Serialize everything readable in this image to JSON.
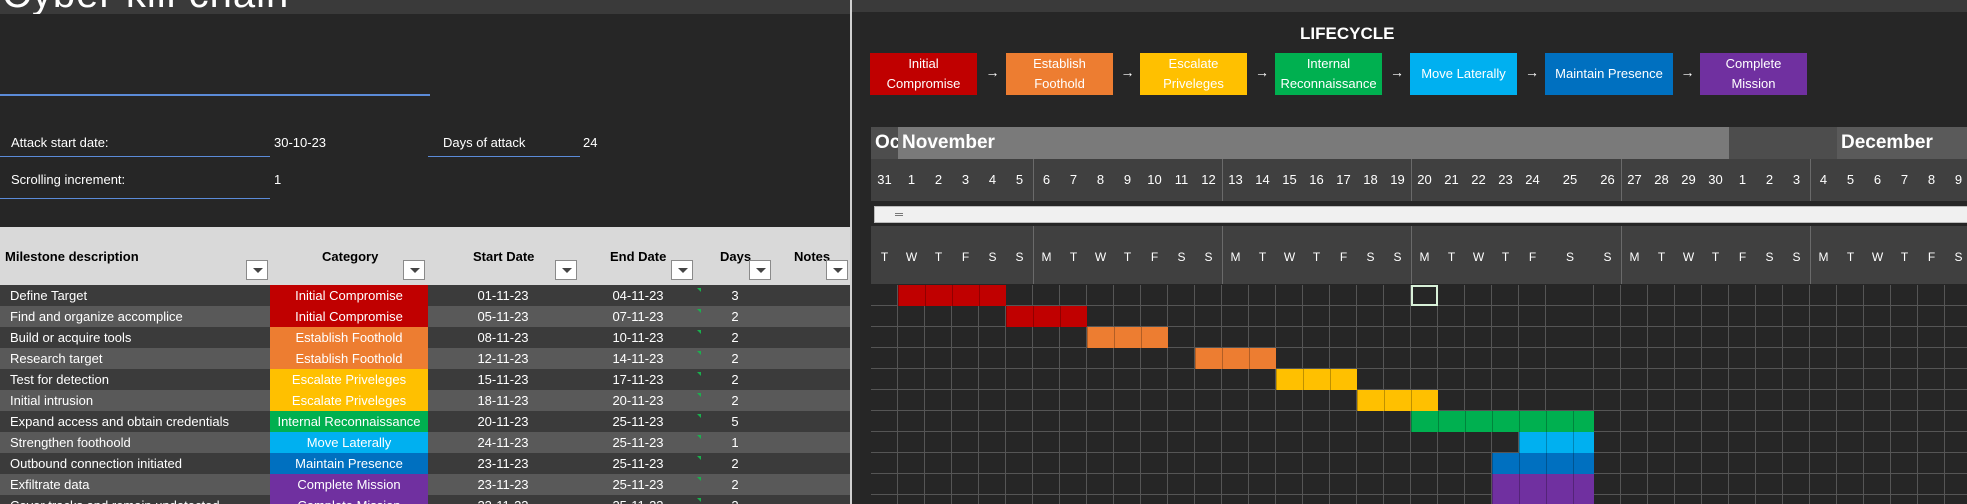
{
  "title": "Cyber kill chain",
  "fields": {
    "attack_start_label": "Attack start date:",
    "attack_start_value": "30-10-23",
    "days_label": "Days of attack",
    "days_value": "24",
    "scroll_label": "Scrolling increment:",
    "scroll_value": "1"
  },
  "table": {
    "headers": [
      "Milestone description",
      "Category",
      "Start Date",
      "End Date",
      "Days",
      "Notes"
    ],
    "rows": [
      {
        "desc": "Define Target",
        "cat": "Initial Compromise",
        "start": "01-11-23",
        "end": "04-11-23",
        "days": "3",
        "color": "#c00000"
      },
      {
        "desc": "Find and organize accomplice",
        "cat": "Initial Compromise",
        "start": "05-11-23",
        "end": "07-11-23",
        "days": "2",
        "color": "#c00000"
      },
      {
        "desc": "Build or acquire tools",
        "cat": "Establish Foothold",
        "start": "08-11-23",
        "end": "10-11-23",
        "days": "2",
        "color": "#ed7d31"
      },
      {
        "desc": "Research target",
        "cat": "Establish Foothold",
        "start": "12-11-23",
        "end": "14-11-23",
        "days": "2",
        "color": "#ed7d31"
      },
      {
        "desc": "Test for detection",
        "cat": "Escalate Priveleges",
        "start": "15-11-23",
        "end": "17-11-23",
        "days": "2",
        "color": "#ffc000"
      },
      {
        "desc": "Initial intrusion",
        "cat": "Escalate Priveleges",
        "start": "18-11-23",
        "end": "20-11-23",
        "days": "2",
        "color": "#ffc000"
      },
      {
        "desc": "Expand access and obtain credentials",
        "cat": "Internal Reconnaissance",
        "start": "20-11-23",
        "end": "25-11-23",
        "days": "5",
        "color": "#00b050"
      },
      {
        "desc": "Strengthen foothoold",
        "cat": "Move Laterally",
        "start": "24-11-23",
        "end": "25-11-23",
        "days": "1",
        "color": "#00b0f0"
      },
      {
        "desc": "Outbound connection initiated",
        "cat": "Maintain Presence",
        "start": "23-11-23",
        "end": "25-11-23",
        "days": "2",
        "color": "#0070c0"
      },
      {
        "desc": "Exfiltrate data",
        "cat": "Complete Mission",
        "start": "23-11-23",
        "end": "25-11-23",
        "days": "2",
        "color": "#7030a0"
      },
      {
        "desc": "Cover tracks and remain undetected",
        "cat": "Complete Mission",
        "start": "23-11-23",
        "end": "25-11-23",
        "days": "2",
        "color": "#7030a0"
      }
    ]
  },
  "lifecycle": {
    "title": "LIFECYCLE",
    "arrow": "→",
    "stages": [
      {
        "line1": "Initial",
        "line2": "Compromise",
        "color": "#c00000"
      },
      {
        "line1": "Establish",
        "line2": "Foothold",
        "color": "#ed7d31"
      },
      {
        "line1": "Escalate",
        "line2": "Priveleges",
        "color": "#ffc000"
      },
      {
        "line1": "Internal",
        "line2": "Reconnaissance",
        "color": "#00b050"
      },
      {
        "line1": "Move Laterally",
        "line2": "",
        "color": "#00b0f0"
      },
      {
        "line1": "Maintain Presence",
        "line2": "",
        "color": "#0070c0"
      },
      {
        "line1": "Complete",
        "line2": "Mission",
        "color": "#7030a0"
      }
    ]
  },
  "timeline": {
    "months": [
      {
        "name": "October",
        "start": 0,
        "span": 1
      },
      {
        "name": "November",
        "start": 1,
        "span": 30
      },
      {
        "name": "December",
        "start": 35,
        "span": 7
      }
    ],
    "days": [
      {
        "n": "31",
        "d": "T"
      },
      {
        "n": "1",
        "d": "W"
      },
      {
        "n": "2",
        "d": "T"
      },
      {
        "n": "3",
        "d": "F"
      },
      {
        "n": "4",
        "d": "S"
      },
      {
        "n": "5",
        "d": "S"
      },
      {
        "n": "6",
        "d": "M"
      },
      {
        "n": "7",
        "d": "T"
      },
      {
        "n": "8",
        "d": "W"
      },
      {
        "n": "9",
        "d": "T"
      },
      {
        "n": "10",
        "d": "F"
      },
      {
        "n": "11",
        "d": "S"
      },
      {
        "n": "12",
        "d": "S"
      },
      {
        "n": "13",
        "d": "M"
      },
      {
        "n": "14",
        "d": "T"
      },
      {
        "n": "15",
        "d": "W"
      },
      {
        "n": "16",
        "d": "T"
      },
      {
        "n": "17",
        "d": "F"
      },
      {
        "n": "18",
        "d": "S"
      },
      {
        "n": "19",
        "d": "S"
      },
      {
        "n": "20",
        "d": "M"
      },
      {
        "n": "21",
        "d": "T"
      },
      {
        "n": "22",
        "d": "W"
      },
      {
        "n": "23",
        "d": "T"
      },
      {
        "n": "24",
        "d": "F"
      },
      {
        "n": "25",
        "d": "S"
      },
      {
        "n": "26",
        "d": "S"
      },
      {
        "n": "27",
        "d": "M"
      },
      {
        "n": "28",
        "d": "T"
      },
      {
        "n": "29",
        "d": "W"
      },
      {
        "n": "30",
        "d": "T"
      },
      {
        "n": "1",
        "d": "F"
      },
      {
        "n": "2",
        "d": "S"
      },
      {
        "n": "3",
        "d": "S"
      },
      {
        "n": "4",
        "d": "M"
      },
      {
        "n": "5",
        "d": "T"
      },
      {
        "n": "6",
        "d": "W"
      },
      {
        "n": "7",
        "d": "T"
      },
      {
        "n": "8",
        "d": "F"
      },
      {
        "n": "9",
        "d": "S"
      }
    ],
    "bars": [
      {
        "row": 0,
        "start": 1,
        "len": 4,
        "color": "#c00000"
      },
      {
        "row": 1,
        "start": 5,
        "len": 3,
        "color": "#c00000"
      },
      {
        "row": 2,
        "start": 8,
        "len": 3,
        "color": "#ed7d31"
      },
      {
        "row": 3,
        "start": 12,
        "len": 3,
        "color": "#ed7d31"
      },
      {
        "row": 4,
        "start": 15,
        "len": 3,
        "color": "#ffc000"
      },
      {
        "row": 5,
        "start": 18,
        "len": 3,
        "color": "#ffc000"
      },
      {
        "row": 6,
        "start": 20,
        "len": 6,
        "color": "#00b050"
      },
      {
        "row": 7,
        "start": 24,
        "len": 2,
        "color": "#00b0f0"
      },
      {
        "row": 8,
        "start": 23,
        "len": 3,
        "color": "#0070c0"
      },
      {
        "row": 9,
        "start": 23,
        "len": 3,
        "color": "#7030a0"
      },
      {
        "row": 10,
        "start": 23,
        "len": 3,
        "color": "#7030a0"
      }
    ],
    "selected": {
      "row": 0,
      "col": 20
    }
  }
}
